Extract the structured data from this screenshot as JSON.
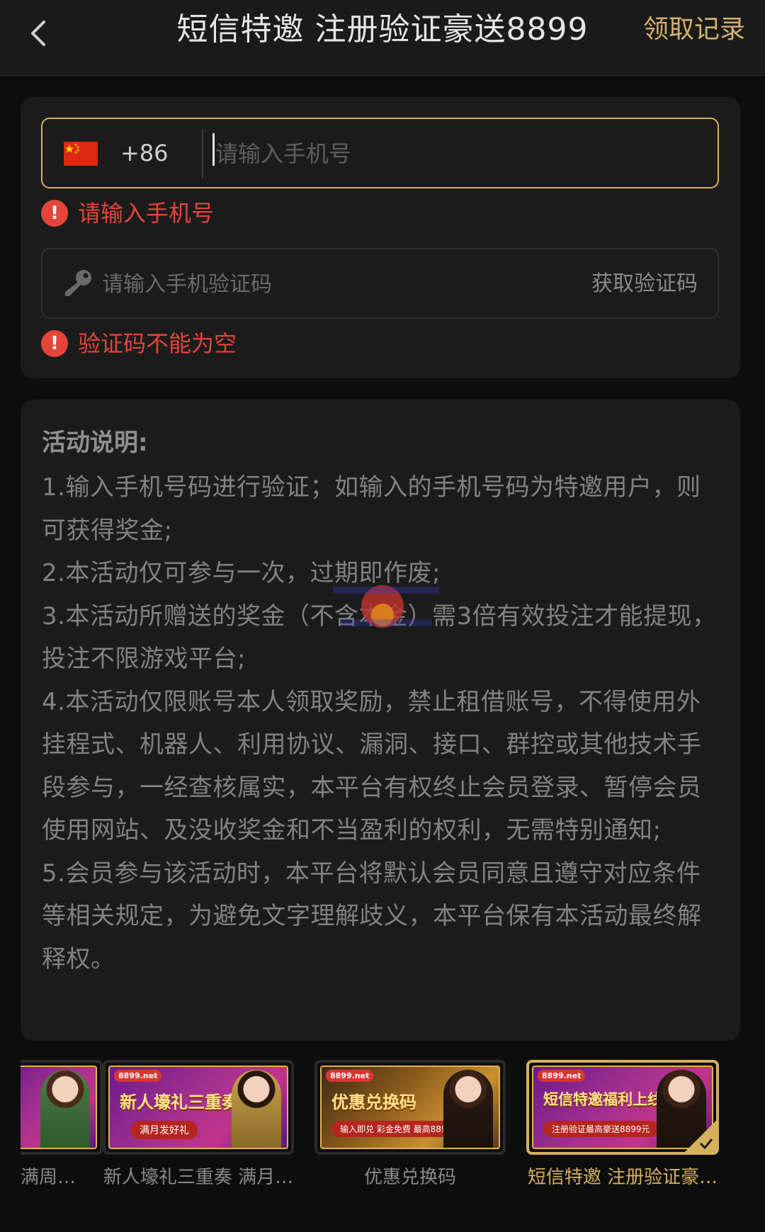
{
  "header": {
    "title": "短信特邀 注册验证豪送8899",
    "record_link": "领取记录"
  },
  "form": {
    "country_code": "+86",
    "phone_placeholder": "请输入手机号",
    "phone_error": "请输入手机号",
    "code_placeholder": "请输入手机验证码",
    "get_code_label": "获取验证码",
    "code_error": "验证码不能为空"
  },
  "description": {
    "title": "活动说明:",
    "items": [
      "1.输入手机号码进行验证；如输入的手机号码为特邀用户，则可获得奖金;",
      "2.本活动仅可参与一次，过期即作废;",
      "3.本活动所赠送的奖金（不含本金）需3倍有效投注才能提现，投注不限游戏平台;",
      "4.本活动仅限账号本人领取奖励，禁止租借账号，不得使用外挂程式、机器人、利用协议、漏洞、接口、群控或其他技术手段参与，一经查核属实，本平台有权终止会员登录、暂停会员使用网站、及没收奖金和不当盈利的权利，无需特别通知;",
      "5.会员参与该活动时，本平台将默认会员同意且遵守对应条件等相关规定，为避免文字理解歧义，本平台保有本活动最终解释权。"
    ]
  },
  "carousel": {
    "items": [
      {
        "label": "满周…",
        "headline": "",
        "sub": "",
        "logo": "",
        "selected": false
      },
      {
        "label": "新人壕礼三重奏 满月…",
        "headline": "新人壕礼三重奏",
        "sub": "满月发好礼",
        "logo": "8899.net",
        "selected": false
      },
      {
        "label": "优惠兑换码",
        "headline": "优惠兑换码",
        "sub": "输入即兑 彩金免费 最高8899元",
        "logo": "8899.net",
        "selected": false
      },
      {
        "label": "短信特邀 注册验证豪…",
        "headline": "短信特邀福利上线",
        "sub": "注册验证最高豪送8899元",
        "logo": "8899.net",
        "selected": true
      }
    ]
  },
  "colors": {
    "accent_gold": "#d6b05d",
    "error_red": "#e5443a",
    "background": "#0d0d0d",
    "card": "#1b1b1b"
  }
}
